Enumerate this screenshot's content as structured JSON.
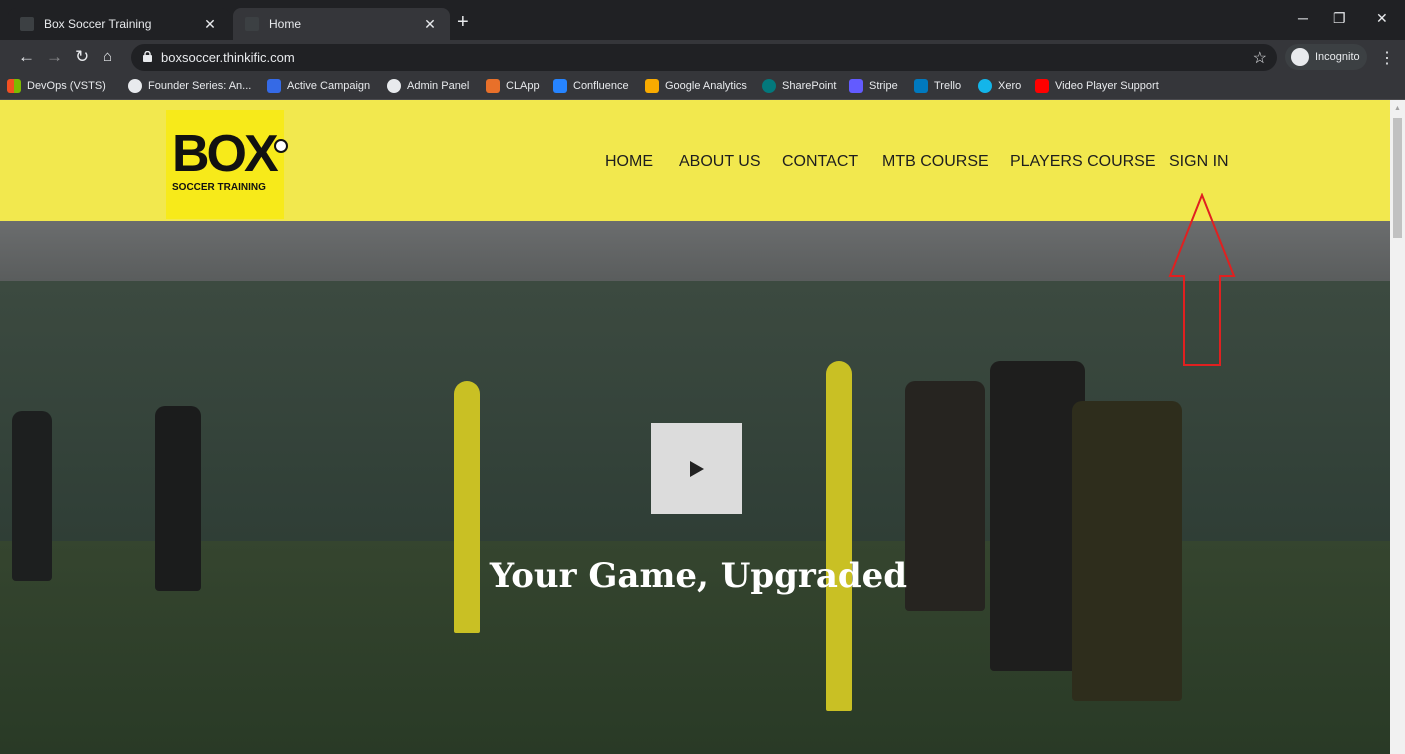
{
  "browser": {
    "tabs": [
      {
        "title": "Box Soccer Training",
        "active": false
      },
      {
        "title": "Home",
        "active": true
      }
    ],
    "new_tab": "+",
    "url": "boxsoccer.thinkific.com",
    "incognito_label": "Incognito",
    "window_controls": {
      "minimize": "─",
      "restore": "❐",
      "close": "✕"
    },
    "bookmarks": [
      {
        "label": "DevOps (VSTS)",
        "icon": "microsoft-icon",
        "color": "#f25022"
      },
      {
        "label": "Founder Series: An...",
        "icon": "globe-icon",
        "color": "#e8eaed"
      },
      {
        "label": "Active Campaign",
        "icon": "activecampaign-icon",
        "color": "#356ae6"
      },
      {
        "label": "Admin Panel",
        "icon": "globe-icon",
        "color": "#e8eaed"
      },
      {
        "label": "CLApp",
        "icon": "clapp-icon",
        "color": "#e8702a"
      },
      {
        "label": "Confluence",
        "icon": "confluence-icon",
        "color": "#2684ff"
      },
      {
        "label": "Google Analytics",
        "icon": "analytics-icon",
        "color": "#f9ab00"
      },
      {
        "label": "SharePoint",
        "icon": "sharepoint-icon",
        "color": "#03787c"
      },
      {
        "label": "Stripe",
        "icon": "stripe-icon",
        "color": "#635bff"
      },
      {
        "label": "Trello",
        "icon": "trello-icon",
        "color": "#0079bf"
      },
      {
        "label": "Xero",
        "icon": "xero-icon",
        "color": "#13b5ea"
      },
      {
        "label": "Video Player Support",
        "icon": "youtube-icon",
        "color": "#ff0000"
      }
    ]
  },
  "site": {
    "logo": {
      "big": "BOX",
      "small": "SOCCER TRAINING"
    },
    "nav": [
      "HOME",
      "ABOUT US",
      "CONTACT",
      "MTB COURSE",
      "PLAYERS COURSE",
      "SIGN IN"
    ],
    "header_color": "#f2e84e",
    "hero_title": "Your Game, Upgraded",
    "annotation_color": "#e02020"
  }
}
